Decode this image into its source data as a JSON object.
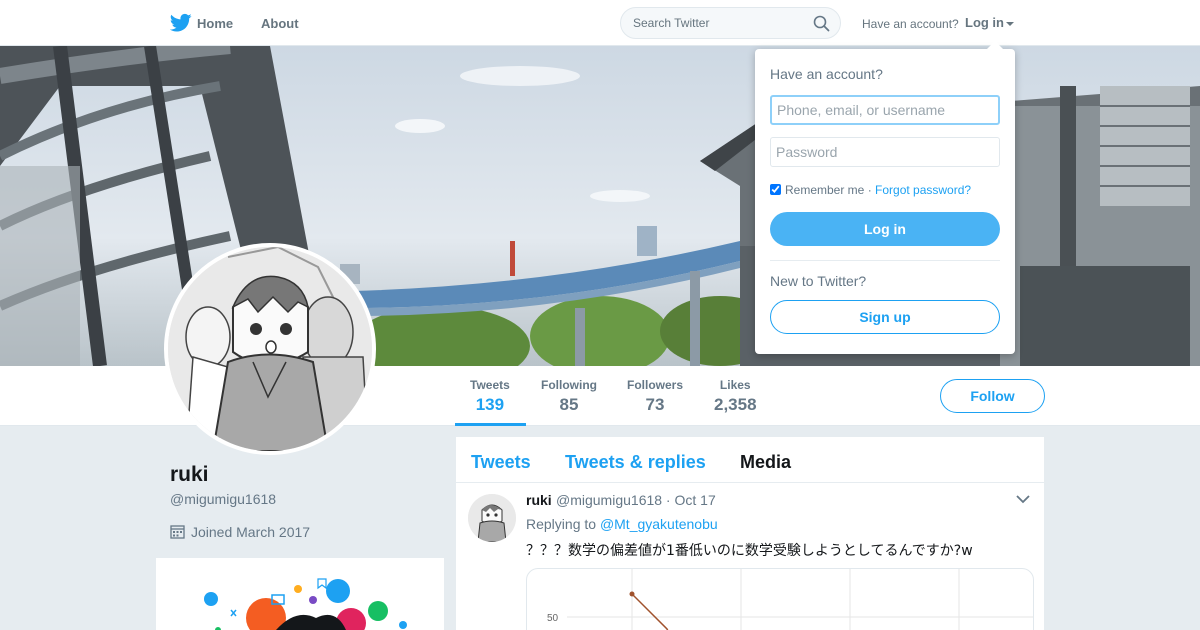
{
  "nav": {
    "home_label": "Home",
    "about_label": "About",
    "search_placeholder": "Search Twitter",
    "have_account": "Have an account?",
    "login_label": "Log in",
    "brand_color": "#1da1f2",
    "icons": [
      "twitter-bird-icon",
      "search-icon",
      "chevron-down-icon"
    ]
  },
  "profile": {
    "name": "ruki",
    "handle": "@migumigu1618",
    "joined": "Joined March 2017",
    "follow_label": "Follow",
    "stats": [
      {
        "label": "Tweets",
        "value": "139",
        "active": true
      },
      {
        "label": "Following",
        "value": "85",
        "active": false
      },
      {
        "label": "Followers",
        "value": "73",
        "active": false
      },
      {
        "label": "Likes",
        "value": "2,358",
        "active": false
      }
    ]
  },
  "timeline": {
    "tabs": [
      "Tweets",
      "Tweets & replies",
      "Media"
    ],
    "tweet": {
      "name": "ruki",
      "handle": "@migumigu1618",
      "date": "Oct 17",
      "replying_prefix": "Replying to",
      "replying_to": "@Mt_gyakutenobu",
      "text": "？？？数学の偏差値が1番低いのに数学受験しようとしてるんですか?w",
      "chart_tick": "50"
    }
  },
  "login_dropdown": {
    "title": "Have an account?",
    "username_placeholder": "Phone, email, or username",
    "password_placeholder": "Password",
    "remember_label": "Remember me",
    "separator": " · ",
    "forgot_label": "Forgot password?",
    "login_button": "Log in",
    "new_label": "New to Twitter?",
    "signup_button": "Sign up"
  }
}
